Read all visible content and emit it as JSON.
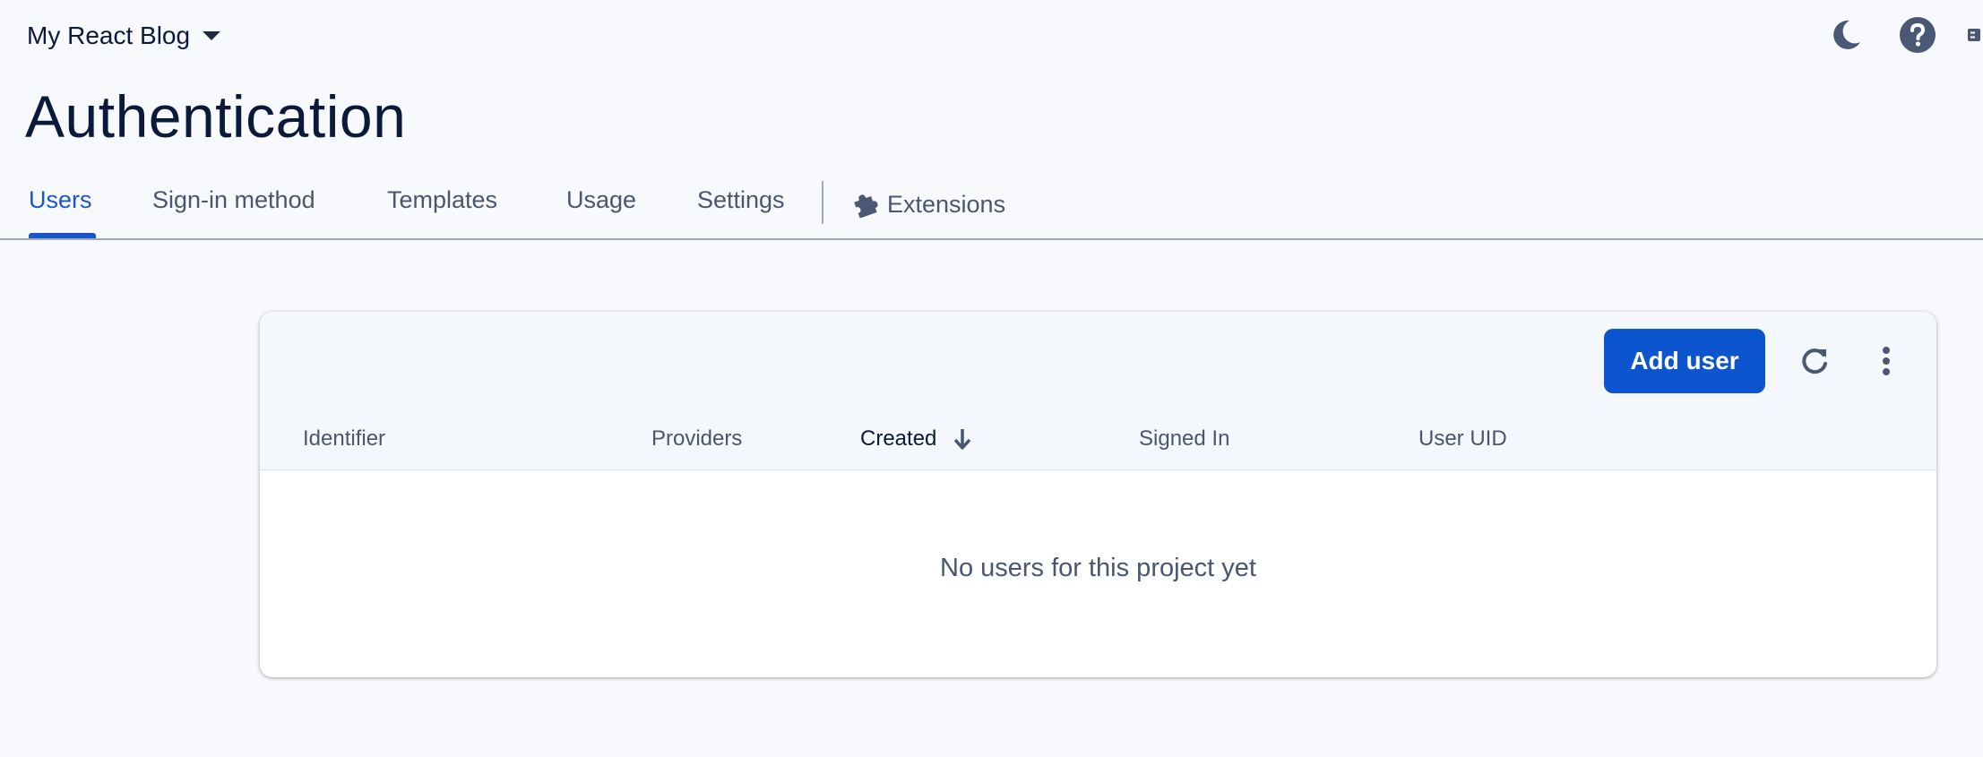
{
  "header": {
    "project_name": "My React Blog",
    "icons": [
      "dark-mode-moon-icon",
      "help-icon",
      "menu-icon"
    ]
  },
  "page": {
    "title": "Authentication"
  },
  "tabs": {
    "users": "Users",
    "sign_in_method": "Sign-in method",
    "templates": "Templates",
    "usage": "Usage",
    "settings": "Settings",
    "extensions": "Extensions",
    "active": "Users"
  },
  "users_table": {
    "add_user_label": "Add user",
    "columns": {
      "identifier": "Identifier",
      "providers": "Providers",
      "created": "Created",
      "signed_in": "Signed In",
      "user_uid": "User UID"
    },
    "sorted_column": "Created",
    "sort_direction": "descending",
    "empty_message": "No users for this project yet",
    "rows": []
  },
  "colors": {
    "accent": "#1a56c9",
    "primary_button": "#0d55cf",
    "background": "#f8f9fc",
    "text_primary": "#0b1a3b",
    "text_secondary": "#4a5670"
  }
}
